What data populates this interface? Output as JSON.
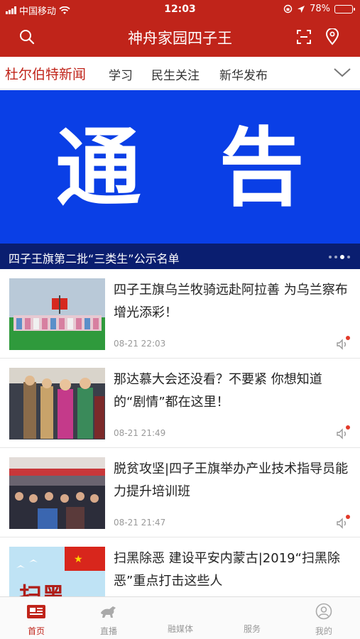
{
  "status": {
    "carrier": "中国移动",
    "time": "12:03",
    "battery": "78%",
    "battery_level": 0.78
  },
  "header": {
    "title": "神舟家园四子王"
  },
  "tabs": [
    "杜尔伯特新闻",
    "学习",
    "民生关注",
    "新华发布"
  ],
  "banner": {
    "big_left": "通",
    "big_right": "告",
    "caption": "四子王旗第二批“三类生”公示名单"
  },
  "news": [
    {
      "title": "四子王旗乌兰牧骑远赴阿拉善 为乌兰察布增光添彩！",
      "date": "08-21 22:03"
    },
    {
      "title": "那达慕大会还没看？不要紧 你想知道的“剧情”都在这里！",
      "date": "08-21 21:49"
    },
    {
      "title": "脱贫攻坚|四子王旗举办产业技术指导员能力提升培训班",
      "date": "08-21 21:47"
    },
    {
      "title": "扫黑除恶 建设平安内蒙古|2019“扫黑除恶”重点打击这些人",
      "date": "",
      "thumb_text": "扫黑"
    }
  ],
  "bottom_nav": [
    {
      "label": "首页",
      "active": true
    },
    {
      "label": "直播"
    },
    {
      "label": "融媒体"
    },
    {
      "label": "服务"
    },
    {
      "label": "我的"
    }
  ],
  "colors": {
    "brand_red": "#c0241a",
    "banner_blue": "#0a3fe6"
  }
}
